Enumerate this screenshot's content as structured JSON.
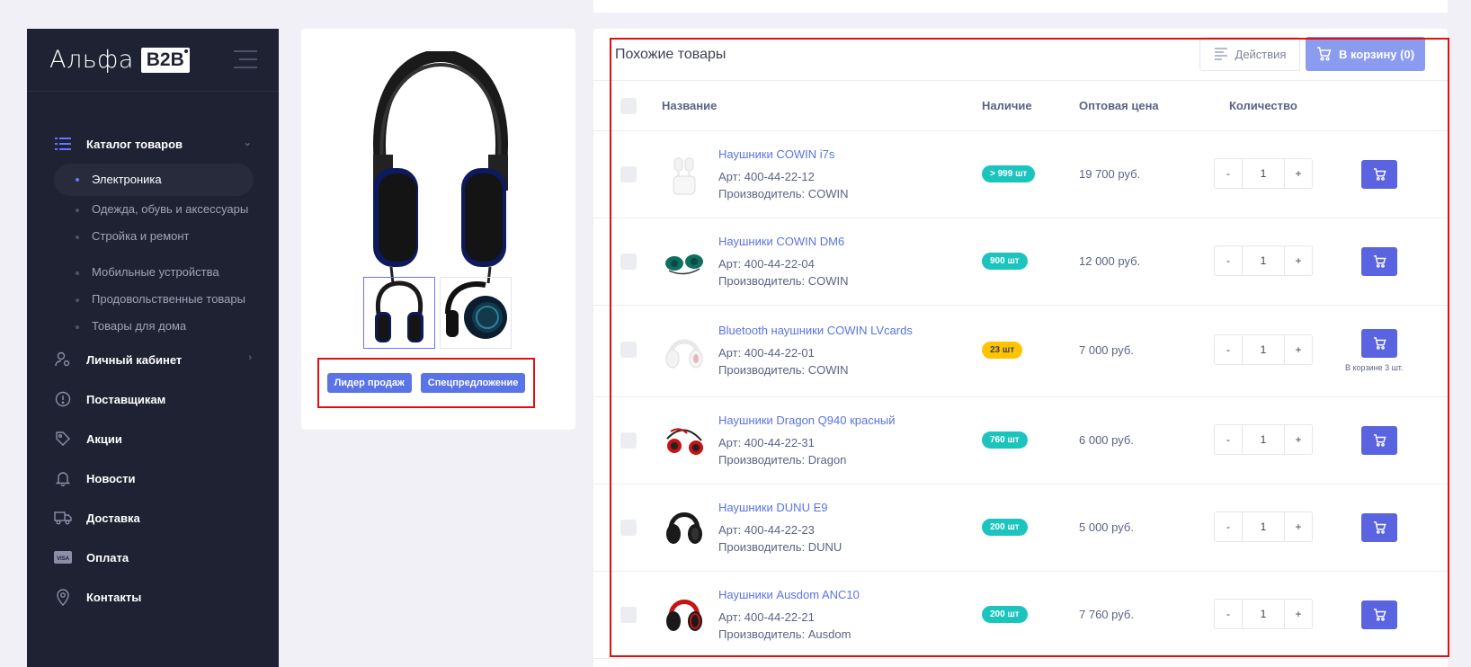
{
  "sidebar": {
    "logo_text": "Альфа",
    "logo_badge": "B2B",
    "catalog_label": "Каталог товаров",
    "subitems": [
      "Электроника",
      "Одежда, обувь и аксессуары",
      "Стройка и ремонт",
      "Мобильные устройства",
      "Продовольственные товары",
      "Товары для дома"
    ],
    "items": [
      {
        "label": "Личный кабинет",
        "icon": "user-gear-icon"
      },
      {
        "label": "Поставщикам",
        "icon": "info-circle-icon"
      },
      {
        "label": "Акции",
        "icon": "tag-icon"
      },
      {
        "label": "Новости",
        "icon": "bell-icon"
      },
      {
        "label": "Доставка",
        "icon": "truck-icon"
      },
      {
        "label": "Оплата",
        "icon": "visa-card-icon"
      },
      {
        "label": "Контакты",
        "icon": "map-pin-icon"
      }
    ]
  },
  "product_card": {
    "badges": [
      "Лидер продаж",
      "Спецпредложение"
    ]
  },
  "panel": {
    "title": "Похожие товары",
    "actions_label": "Действия",
    "cart_label": "В корзину (0)",
    "columns": {
      "name": "Название",
      "stock": "Наличие",
      "price": "Оптовая цена",
      "qty": "Количество"
    },
    "rows": [
      {
        "name": "Наушники COWIN i7s",
        "art": "Арт: 400-44-22-12",
        "maker": "Производитель: COWIN",
        "stock": "> 999 шт",
        "stock_color": "#1bc5bd",
        "price": "19 700 руб.",
        "qty": "1",
        "minus": "-",
        "plus": "+"
      },
      {
        "name": "Наушники COWIN DM6",
        "art": "Арт: 400-44-22-04",
        "maker": "Производитель: COWIN",
        "stock": "900 шт",
        "stock_color": "#1bc5bd",
        "price": "12 000 руб.",
        "qty": "1",
        "minus": "-",
        "plus": "+"
      },
      {
        "name": "Bluetooth наушники COWIN LVcards",
        "art": "Арт: 400-44-22-01",
        "maker": "Производитель: COWIN",
        "stock": "23 шт",
        "stock_color": "#ffc300",
        "price": "7 000 руб.",
        "qty": "1",
        "minus": "-",
        "plus": "+",
        "in_cart": "В корзине 3 шт."
      },
      {
        "name": "Наушники Dragon Q940 красный",
        "art": "Арт: 400-44-22-31",
        "maker": "Производитель: Dragon",
        "stock": "760 шт",
        "stock_color": "#1bc5bd",
        "price": "6 000 руб.",
        "qty": "1",
        "minus": "-",
        "plus": "+"
      },
      {
        "name": "Наушники DUNU E9",
        "art": "Арт: 400-44-22-23",
        "maker": "Производитель: DUNU",
        "stock": "200 шт",
        "stock_color": "#1bc5bd",
        "price": "5 000 руб.",
        "qty": "1",
        "minus": "-",
        "plus": "+"
      },
      {
        "name": "Наушники Ausdom ANC10",
        "art": "Арт: 400-44-22-21",
        "maker": "Производитель: Ausdom",
        "stock": "200 шт",
        "stock_color": "#1bc5bd",
        "price": "7 760 руб.",
        "qty": "1",
        "minus": "-",
        "plus": "+"
      }
    ]
  }
}
